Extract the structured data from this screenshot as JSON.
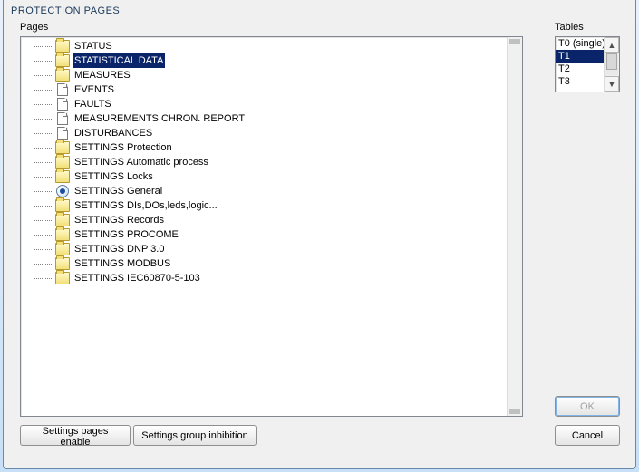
{
  "window": {
    "title": "PROTECTION PAGES"
  },
  "labels": {
    "pages": "Pages",
    "tables": "Tables"
  },
  "tree": {
    "items": [
      {
        "icon": "folder",
        "label": "STATUS",
        "selected": false
      },
      {
        "icon": "folder",
        "label": "STATISTICAL DATA",
        "selected": true
      },
      {
        "icon": "folder",
        "label": "MEASURES",
        "selected": false
      },
      {
        "icon": "doc",
        "label": "EVENTS",
        "selected": false
      },
      {
        "icon": "doc",
        "label": "FAULTS",
        "selected": false
      },
      {
        "icon": "doc",
        "label": "MEASUREMENTS CHRON. REPORT",
        "selected": false
      },
      {
        "icon": "doc",
        "label": "DISTURBANCES",
        "selected": false
      },
      {
        "icon": "folder",
        "label": "SETTINGS Protection",
        "selected": false
      },
      {
        "icon": "folder",
        "label": "SETTINGS Automatic process",
        "selected": false
      },
      {
        "icon": "folder",
        "label": "SETTINGS Locks",
        "selected": false
      },
      {
        "icon": "radio",
        "label": "SETTINGS General",
        "selected": false
      },
      {
        "icon": "folder",
        "label": "SETTINGS DIs,DOs,leds,logic...",
        "selected": false
      },
      {
        "icon": "folder",
        "label": "SETTINGS Records",
        "selected": false
      },
      {
        "icon": "folder",
        "label": "SETTINGS PROCOME",
        "selected": false
      },
      {
        "icon": "folder",
        "label": "SETTINGS DNP 3.0",
        "selected": false
      },
      {
        "icon": "folder",
        "label": "SETTINGS MODBUS",
        "selected": false
      },
      {
        "icon": "folder",
        "label": "SETTINGS IEC60870-5-103",
        "selected": false
      }
    ]
  },
  "tables": {
    "items": [
      {
        "label": "T0 (single)",
        "selected": false
      },
      {
        "label": "T1",
        "selected": true
      },
      {
        "label": "T2",
        "selected": false
      },
      {
        "label": "T3",
        "selected": false
      }
    ]
  },
  "buttons": {
    "ok": "OK",
    "cancel": "Cancel",
    "settings_pages_enable": "Settings pages enable",
    "settings_group_inhibition": "Settings group inhibition"
  },
  "ok_enabled": false
}
